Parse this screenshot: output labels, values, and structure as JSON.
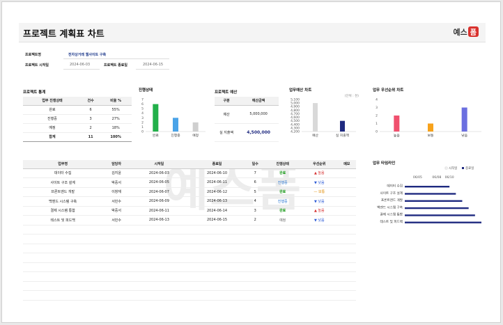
{
  "header": {
    "title": "프로젝트 계획표 차트",
    "logo_text": "예스",
    "logo_badge": "폼"
  },
  "info": {
    "name_label": "프로젝트명",
    "name_value": "전자상거래 웹사이트 구축",
    "start_label": "프로젝트 시작일",
    "start_value": "2024-06-03",
    "end_label": "프로젝트 종료일",
    "end_value": "2024-06-15"
  },
  "stats": {
    "title": "프로젝트 통계",
    "headers": [
      "업무 진행상태",
      "건수",
      "비율 %"
    ],
    "rows": [
      [
        "완료",
        "6",
        "55%"
      ],
      [
        "진행중",
        "3",
        "27%"
      ],
      [
        "예정",
        "2",
        "18%"
      ]
    ],
    "total": [
      "합계",
      "11",
      "100%"
    ]
  },
  "status_chart": {
    "title": "진행상태",
    "categories": [
      "완료",
      "진행중",
      "예정"
    ],
    "values": [
      6,
      3,
      2
    ],
    "colors": [
      "#22b04a",
      "#4aa3e8",
      "#cfcfcf"
    ],
    "ylim": [
      0,
      7
    ],
    "yticks": [
      "0",
      "1",
      "2",
      "3",
      "4",
      "5",
      "6",
      "7"
    ]
  },
  "budget": {
    "title": "프로젝트 예산",
    "headers": [
      "구분",
      "예산금액"
    ],
    "rows": [
      [
        "예산",
        "5,000,000"
      ],
      [
        "실 지출액",
        "4,500,000"
      ]
    ]
  },
  "budget_chart": {
    "title": "업무예산 차트",
    "unit": "(단위 : 천)",
    "categories": [
      "예산",
      "실 지출액"
    ],
    "values": [
      5000,
      4500
    ],
    "colors": [
      "#d9d9d9",
      "#1f2a80"
    ],
    "ylim": [
      4200,
      5100
    ],
    "yticks": [
      "4,200",
      "4,300",
      "4,400",
      "4,500",
      "4,600",
      "4,700",
      "4,800",
      "4,900",
      "5,000",
      "5,100"
    ]
  },
  "priority_chart": {
    "title": "업무 우선순위 차트",
    "categories": [
      "높음",
      "보통",
      "낮음"
    ],
    "values": [
      2,
      1,
      3
    ],
    "colors": [
      "#f0506e",
      "#f7a21b",
      "#6b6fe0"
    ],
    "ylim": [
      0,
      4
    ],
    "yticks": [
      "0",
      "1",
      "2",
      "3",
      "4"
    ]
  },
  "tasks": {
    "headers": [
      "업무명",
      "담당자",
      "시작일",
      "종료일",
      "일수",
      "진행상태",
      "우선순위",
      "메모"
    ],
    "rows": [
      [
        "데이터 수집",
        "김지윤",
        "2024-06-03",
        "2024-06-10",
        "7",
        "완료",
        "▲ 높음",
        ""
      ],
      [
        "사이트 구조 설계",
        "박중서",
        "2024-06-05",
        "2024-06-11",
        "6",
        "진행중",
        "▼ 낮음",
        ""
      ],
      [
        "프론트엔드 개발",
        "이창재",
        "2024-06-07",
        "2024-06-12",
        "5",
        "완료",
        "— 보통",
        ""
      ],
      [
        "백엔드 시스템 구축",
        "서민수",
        "2024-06-09",
        "2024-06-13",
        "4",
        "진행중",
        "▼ 낮음",
        ""
      ],
      [
        "결제 시스템 통합",
        "박중서",
        "2024-06-11",
        "2024-06-14",
        "3",
        "완료",
        "▲ 높음",
        ""
      ],
      [
        "테스트 및 피드백",
        "서민수",
        "2024-06-13",
        "2024-06-15",
        "2",
        "예정",
        "▼ 낮음",
        ""
      ]
    ],
    "status_classes": [
      "status-done",
      "status-prog",
      "status-done",
      "status-prog",
      "status-done",
      "status-plan"
    ],
    "priority_classes": [
      "pr-high",
      "pr-low",
      "pr-mid",
      "pr-low",
      "pr-high",
      "pr-low"
    ]
  },
  "timeline_chart": {
    "title": "업무 타임라인",
    "legend": [
      "시작일",
      "종료일"
    ],
    "x_ticks": [
      "06/05",
      "06/08",
      "06/10"
    ],
    "tasks": [
      "데이터 수집",
      "사이트 구조 설계",
      "프론트엔드 개발",
      "백엔드 시스템 구축",
      "결제 시스템 통합",
      "테스트 및 피드백"
    ],
    "start_day": [
      3,
      5,
      7,
      9,
      11,
      13
    ],
    "end_day": [
      10,
      11,
      12,
      13,
      14,
      15
    ],
    "bar_color": "#1f2a80"
  },
  "watermark": "예스폼"
}
